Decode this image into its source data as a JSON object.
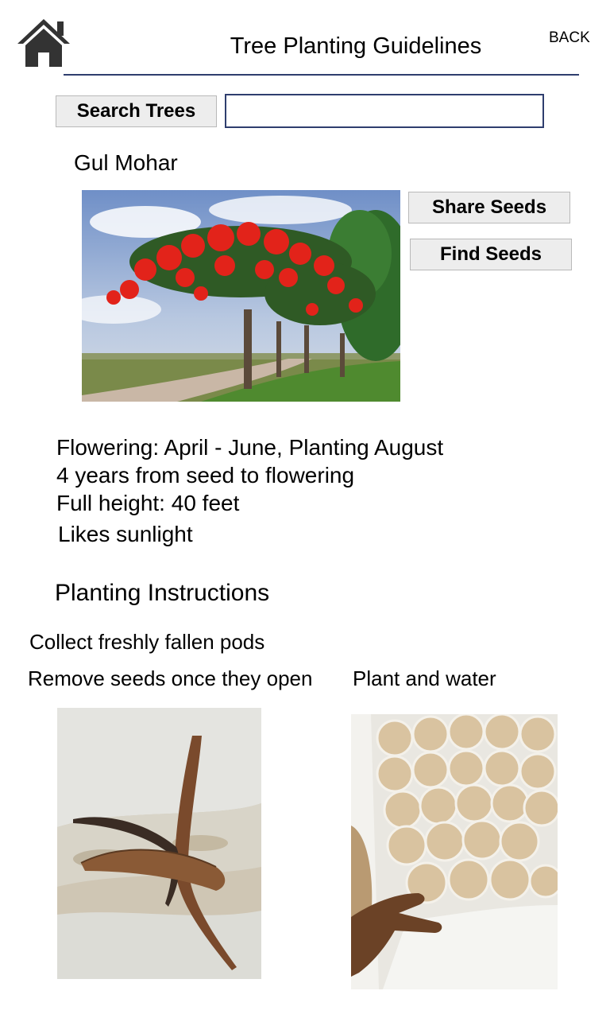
{
  "header": {
    "title": "Tree Planting Guidelines",
    "back_label": "BACK",
    "home_icon": "home-icon"
  },
  "search": {
    "button_label": "Search Trees",
    "value": "",
    "placeholder": ""
  },
  "tree": {
    "name": "Gul Mohar",
    "photo_icon": "flowering-tree-photo",
    "actions": {
      "share_label": "Share Seeds",
      "find_label": "Find Seeds"
    },
    "facts": [
      "Flowering: April - June, Planting August",
      "4 years from seed to flowering",
      "Full height: 40 feet",
      "Likes sunlight"
    ]
  },
  "instructions": {
    "heading": "Planting Instructions",
    "steps": [
      "Collect freshly fallen pods",
      "Remove seeds once they open",
      "Plant and water"
    ]
  },
  "colors": {
    "accent": "#2f3e6e",
    "button_bg": "#ededed",
    "flower_red": "#e2231a"
  }
}
